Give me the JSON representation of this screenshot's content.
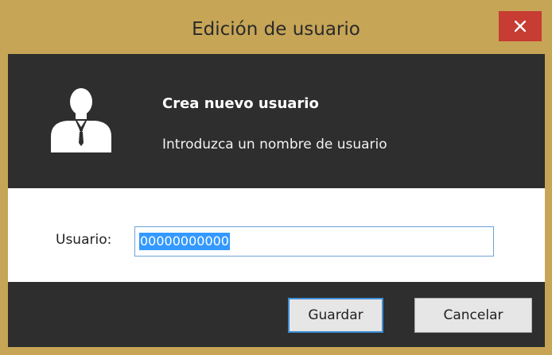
{
  "window": {
    "title": "Edición de usuario",
    "close_icon": "close-icon",
    "colors": {
      "frame": "#c6a556",
      "close_button": "#c73c33",
      "panel": "#2e2e2e",
      "selection": "#3399ff"
    }
  },
  "header": {
    "icon": "user-icon",
    "title": "Crea nuevo usuario",
    "subtitle": "Introduzca un nombre de usuario"
  },
  "form": {
    "username_label": "Usuario:",
    "username_value": "00000000000"
  },
  "buttons": {
    "save_label": "Guardar",
    "cancel_label": "Cancelar"
  }
}
